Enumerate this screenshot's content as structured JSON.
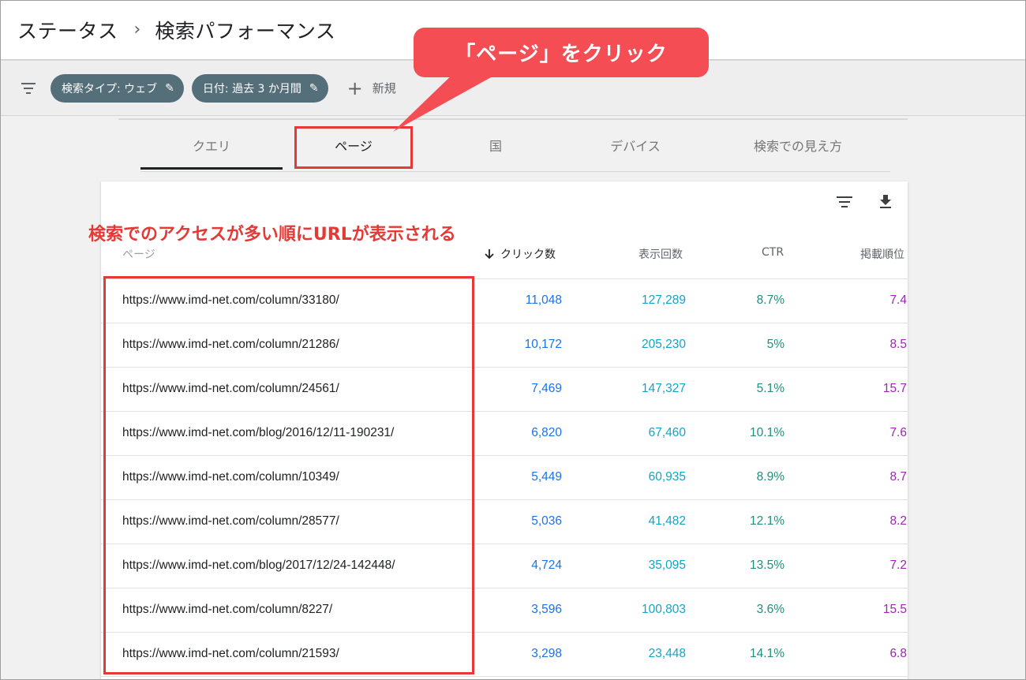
{
  "header": {
    "breadcrumb_root": "ステータス",
    "breadcrumb_sep": "›",
    "title": "検索パフォーマンス"
  },
  "filters": {
    "chips": [
      {
        "label": "検索タイプ: ウェブ"
      },
      {
        "label": "日付: 過去 3 か月間"
      }
    ],
    "new_label": "新規"
  },
  "tabs": [
    {
      "label": "クエリ"
    },
    {
      "label": "ページ"
    },
    {
      "label": "国"
    },
    {
      "label": "デバイス"
    },
    {
      "label": "検索での見え方"
    }
  ],
  "annotations": {
    "callout": "「ページ」をクリック",
    "note": "検索でのアクセスが多い順にURLが表示される"
  },
  "table": {
    "headers": {
      "page": "ページ",
      "clicks": "クリック数",
      "impressions": "表示回数",
      "ctr": "CTR",
      "position": "掲載順位"
    },
    "rows": [
      {
        "url": "https://www.imd-net.com/column/33180/",
        "clicks": "11,048",
        "impressions": "127,289",
        "ctr": "8.7%",
        "position": "7.4"
      },
      {
        "url": "https://www.imd-net.com/column/21286/",
        "clicks": "10,172",
        "impressions": "205,230",
        "ctr": "5%",
        "position": "8.5"
      },
      {
        "url": "https://www.imd-net.com/column/24561/",
        "clicks": "7,469",
        "impressions": "147,327",
        "ctr": "5.1%",
        "position": "15.7"
      },
      {
        "url": "https://www.imd-net.com/blog/2016/12/11-190231/",
        "clicks": "6,820",
        "impressions": "67,460",
        "ctr": "10.1%",
        "position": "7.6"
      },
      {
        "url": "https://www.imd-net.com/column/10349/",
        "clicks": "5,449",
        "impressions": "60,935",
        "ctr": "8.9%",
        "position": "8.7"
      },
      {
        "url": "https://www.imd-net.com/column/28577/",
        "clicks": "5,036",
        "impressions": "41,482",
        "ctr": "12.1%",
        "position": "8.2"
      },
      {
        "url": "https://www.imd-net.com/blog/2017/12/24-142448/",
        "clicks": "4,724",
        "impressions": "35,095",
        "ctr": "13.5%",
        "position": "7.2"
      },
      {
        "url": "https://www.imd-net.com/column/8227/",
        "clicks": "3,596",
        "impressions": "100,803",
        "ctr": "3.6%",
        "position": "15.5"
      },
      {
        "url": "https://www.imd-net.com/column/21593/",
        "clicks": "3,298",
        "impressions": "23,448",
        "ctr": "14.1%",
        "position": "6.8"
      }
    ]
  },
  "icons": {
    "filter": "filter-icon",
    "pencil": "pencil-icon",
    "plus": "plus-icon",
    "download": "download-icon",
    "sort": "arrow-down-icon"
  },
  "colors": {
    "clicks": "#1a73e8",
    "impressions": "#12a4c8",
    "ctr": "#1e8e7e",
    "position": "#9c27b0",
    "chip_bg": "#546e7a",
    "annotation_red": "#e53935",
    "callout_bg": "#f44e54"
  }
}
